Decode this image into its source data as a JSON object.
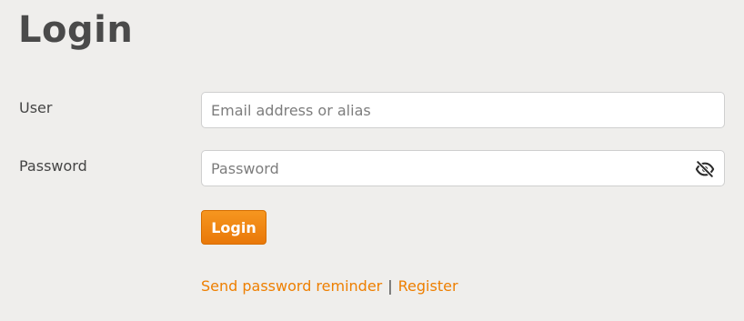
{
  "page": {
    "title": "Login"
  },
  "form": {
    "user_label": "User",
    "user_placeholder": "Email address or alias",
    "user_value": "",
    "password_label": "Password",
    "password_placeholder": "Password",
    "password_value": "",
    "password_toggle_icon": "eye-slash-icon",
    "login_button_label": "Login"
  },
  "links": {
    "send_reminder": "Send password reminder",
    "separator": "|",
    "register": "Register"
  },
  "colors": {
    "background": "#efeeec",
    "accent": "#ee7f00",
    "button_gradient_top": "#f6961f",
    "button_gradient_bottom": "#e97809"
  }
}
